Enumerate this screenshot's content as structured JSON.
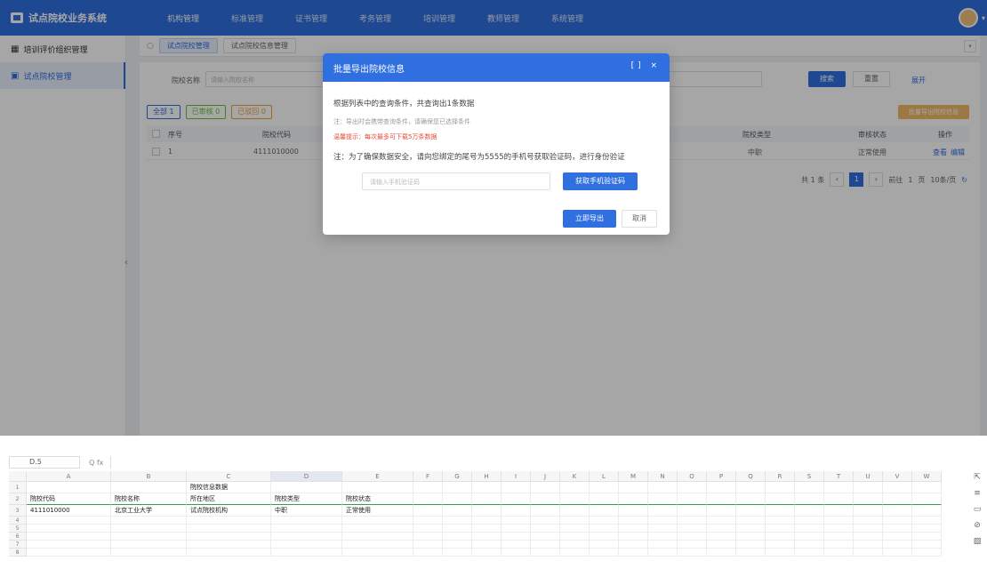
{
  "app": {
    "title": "试点院校业务系统",
    "nav": [
      "机构管理",
      "标准管理",
      "证书管理",
      "考务管理",
      "培训管理",
      "教师管理",
      "系统管理"
    ]
  },
  "sidebar": {
    "items": [
      {
        "label": "培训评价组织管理"
      },
      {
        "label": "试点院校管理"
      }
    ]
  },
  "tabs": {
    "items": [
      "试点院校管理",
      "试点院校信息管理"
    ]
  },
  "search": {
    "label": "院校名称",
    "placeholder": "请输入院校名称",
    "search_button": "搜索",
    "reset_button": "重置",
    "expand_link": "展开"
  },
  "filters": {
    "all": "全部 1",
    "pass": "已审核 0",
    "reject": "已驳回 0",
    "export": "批量导出院校信息"
  },
  "table": {
    "columns": [
      "序号",
      "院校代码",
      "院校类型",
      "审核状态",
      "操作"
    ],
    "rows": [
      {
        "index": "1",
        "code": "4111010000",
        "type": "中职",
        "status": "正常使用",
        "op1": "查看",
        "op2": "编辑"
      }
    ]
  },
  "pager": {
    "total": "共 1 条",
    "page": "1",
    "goto": "前往",
    "goto_page": "1",
    "page_unit": "页",
    "page_size": "10条/页"
  },
  "modal": {
    "title": "批量导出院校信息",
    "tools": "[] ×",
    "line1": "根据列表中的查询条件，共查询出1条数据",
    "line2": "注：导出时会携带查询条件，请确保您已选择条件",
    "line3": "温馨提示：每次最多可下载5万条数据",
    "line4": "注：为了确保数据安全，请向您绑定的尾号为5555的手机号获取验证码，进行身份验证",
    "code_placeholder": "请输入手机验证码",
    "get_code": "获取手机验证码",
    "confirm": "立即导出",
    "cancel": "取消"
  },
  "sheet": {
    "cell_ref": "D.5",
    "fx": "Q fx",
    "columns": [
      "A",
      "B",
      "C",
      "D",
      "E",
      "F",
      "G",
      "H",
      "I",
      "J",
      "K",
      "L",
      "M",
      "N",
      "O",
      "P",
      "Q",
      "R",
      "S",
      "T",
      "U",
      "V",
      "W"
    ],
    "title_cell": "院校信息数据",
    "header_row": [
      "院校代码",
      "院校名称",
      "所在地区",
      "院校类型",
      "院校状态"
    ],
    "data_row": [
      "4111010000",
      "北京工业大学",
      "试点院校机构",
      "中职",
      "正常使用"
    ],
    "row_numbers": [
      "1",
      "2",
      "3",
      "4",
      "5",
      "6",
      "7",
      "8"
    ]
  }
}
